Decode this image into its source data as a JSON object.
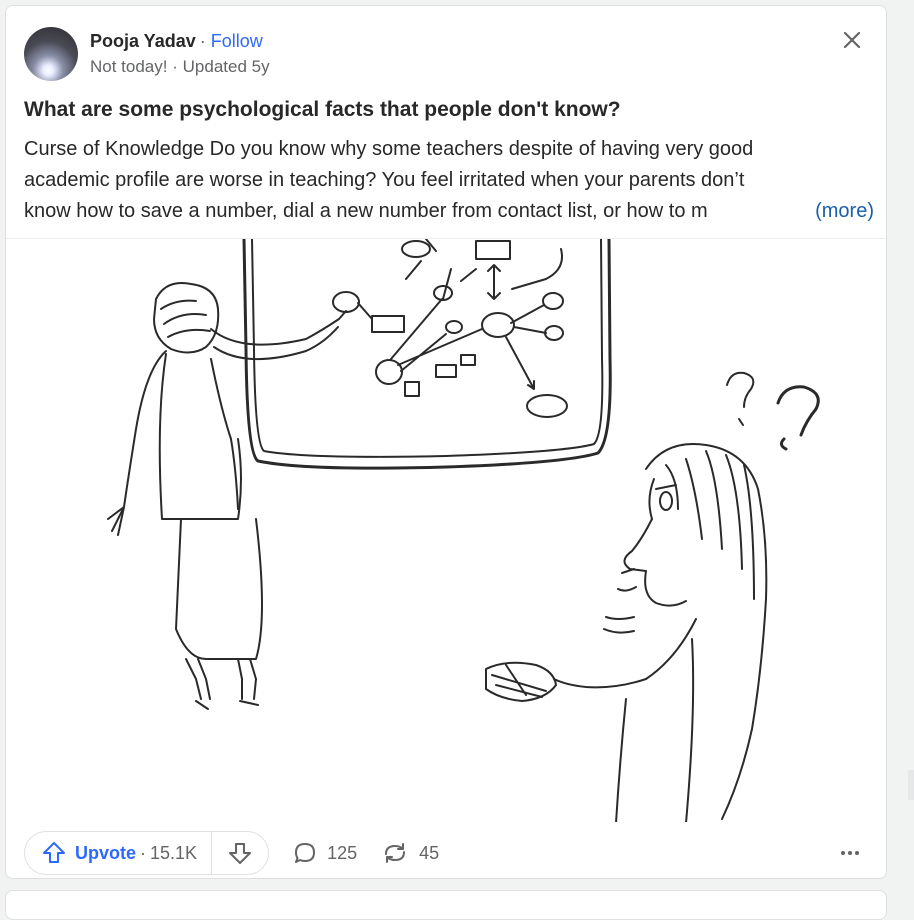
{
  "post": {
    "author": "Pooja Yadav",
    "separator": "·",
    "follow_label": "Follow",
    "credential": "Not today!",
    "updated": "Updated 5y",
    "question": "What are some psychological facts that people don't know?",
    "excerpt_lines": [
      "Curse of Knowledge Do you know why some teachers despite of having very good",
      "academic profile are worse in teaching? You feel irritated when your parents don’t",
      "know how to save a number, dial a new number from contact list, or how to m"
    ],
    "more_label": "(more)",
    "image_alt": "Sketch of a teacher pointing at a diagram on a board and a confused student"
  },
  "actions": {
    "upvote_label": "Upvote",
    "upvote_separator": "·",
    "upvote_count": "15.1K",
    "comments_count": "125",
    "shares_count": "45"
  },
  "icons": {
    "close": "close-icon",
    "upvote": "upvote-arrow-icon",
    "downvote": "downvote-arrow-icon",
    "comment": "comment-bubble-icon",
    "share": "reshare-icon",
    "more": "more-horizontal-icon"
  },
  "colors": {
    "accent_blue": "#2e69ff",
    "link_blue": "#195faa",
    "text_primary": "#282829",
    "text_secondary": "#636466",
    "border": "#dee0e1"
  }
}
